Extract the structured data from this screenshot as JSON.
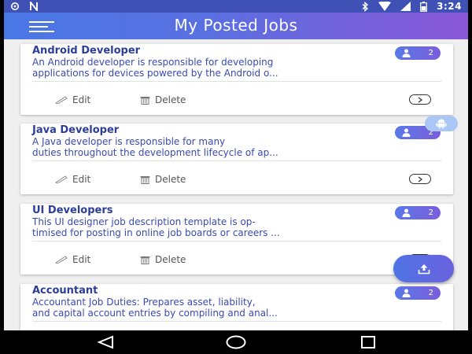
{
  "status_bar": {
    "time": "3:24",
    "left_icons": [
      "settings-icon",
      "n-notification-icon"
    ],
    "right_icons": [
      "bluetooth-icon",
      "wifi-icon",
      "signal-icon",
      "battery-icon"
    ]
  },
  "app_bar": {
    "title": "My Posted Jobs",
    "menu_icon": "menu-icon"
  },
  "jobs": [
    {
      "title": "Android Developer",
      "desc_line1": "An Android developer is responsible for developing",
      "desc_line2": "applications for devices powered by the Android o...",
      "count": "2",
      "edit_label": "Edit",
      "delete_label": "Delete"
    },
    {
      "title": "Java Developer",
      "desc_line1": "A Java developer is responsible for many",
      "desc_line2": "duties throughout the development lifecycle of ap...",
      "count": "2",
      "edit_label": "Edit",
      "delete_label": "Delete"
    },
    {
      "title": "UI Developers",
      "desc_line1": "This UI designer job description template is op-",
      "desc_line2": "timised for posting in online job boards or careers ...",
      "count": "2",
      "edit_label": "Edit",
      "delete_label": "Delete"
    },
    {
      "title": "Accountant",
      "desc_line1": "Accountant Job Duties: Prepares asset, liability,",
      "desc_line2": "and capital account entries by compiling and anal...",
      "count": "2"
    }
  ],
  "fab": {
    "icon": "upload-icon"
  },
  "nav_bar": {
    "icons": [
      "back-icon",
      "home-icon",
      "recents-icon"
    ]
  },
  "colors": {
    "primary_text": "#2d3d9a",
    "accent_start": "#4a77e6",
    "accent_end": "#8a57d8"
  }
}
